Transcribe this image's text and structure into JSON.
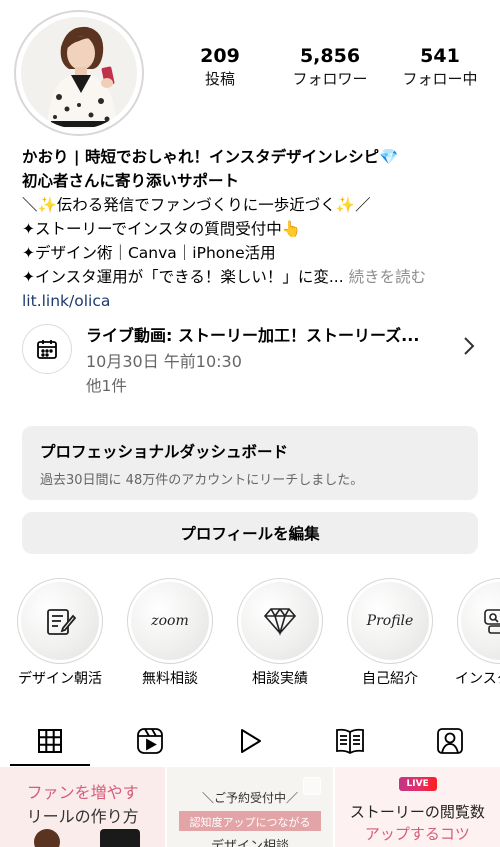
{
  "profile": {
    "stats": [
      {
        "value": "209",
        "label": "投稿"
      },
      {
        "value": "5,856",
        "label": "フォロワー"
      },
      {
        "value": "541",
        "label": "フォロー中"
      }
    ]
  },
  "bio": {
    "name_line": "かおり | 時短でおしゃれ！インスタデザインレシピ💎",
    "line2": "初心者さんに寄り添いサポート",
    "line3": "＼✨伝わる発信でファンづくりに一歩近づく✨／",
    "line4": "✦ストーリーでインスタの質問受付中👆",
    "line5": "✦デザイン術｜Canva｜iPhone活用",
    "line6": "✦インスタ運用が「できる！楽しい！」に変...",
    "more": "続きを読む",
    "link": "lit.link/olica"
  },
  "event": {
    "title": "ライブ動画: ストーリー加工！ストーリーズ...",
    "time": "10月30日 午前10:30",
    "more": "他1件"
  },
  "dashboard": {
    "title": "プロフェッショナルダッシュボード",
    "subtitle": "過去30日間に 48万件のアカウントにリーチしました。"
  },
  "edit_profile_label": "プロフィールを編集",
  "highlights": [
    {
      "label": "デザイン朝活",
      "icon": "notepad-pen-icon",
      "text": ""
    },
    {
      "label": "無料相談",
      "icon": "",
      "text": "zoom"
    },
    {
      "label": "相談実績",
      "icon": "diamond-icon",
      "text": ""
    },
    {
      "label": "自己紹介",
      "icon": "",
      "text": "Profile"
    },
    {
      "label": "インスタ",
      "icon": "qa-icon",
      "text": ""
    }
  ],
  "tabs": [
    "grid-icon",
    "reels-icon",
    "play-icon",
    "guide-book-icon",
    "tagged-icon"
  ],
  "posts": [
    {
      "line1": "ファンを増やす",
      "line2": "リールの作り方"
    },
    {
      "line1": "＼ご予約受付中／",
      "line2": "認知度アップにつながる",
      "line3": "デザイン相談"
    },
    {
      "badge": "LIVE",
      "line1": "ストーリーの閲覧数",
      "line2": "アップするコツ"
    }
  ],
  "colors": {
    "accent_pink": "#e2728a",
    "link_blue": "#1d3a6b",
    "secondary_text": "#8e8e8e",
    "card_bg": "#efefef"
  }
}
